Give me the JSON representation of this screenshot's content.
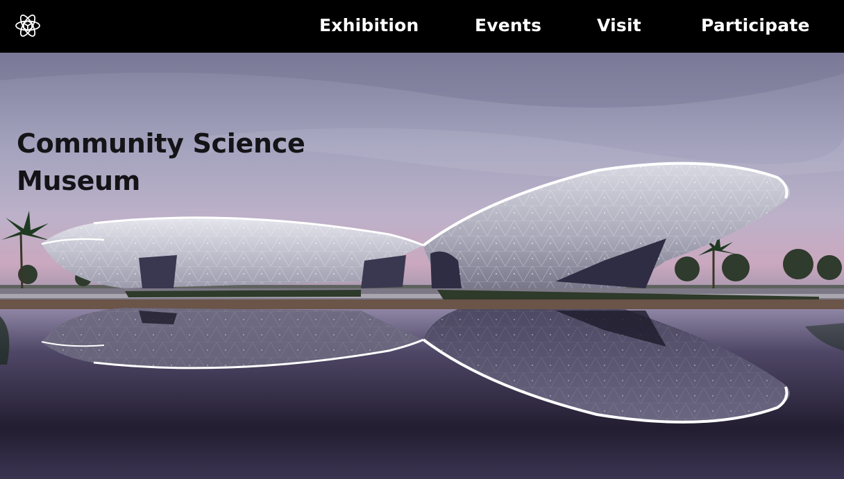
{
  "header": {
    "logo_icon": "atom-cube-icon",
    "nav": [
      {
        "label": "Exhibition"
      },
      {
        "label": "Events"
      },
      {
        "label": "Visit"
      },
      {
        "label": "Participate"
      }
    ]
  },
  "hero": {
    "title_line1": "Community Science",
    "title_line2": "Museum",
    "image_subject": "futuristic-museum-building-with-reflecting-pool-icon"
  },
  "colors": {
    "nav_background": "#000000",
    "nav_text": "#ffffff",
    "title_text": "#141418",
    "sky_top": "#8c8aa6",
    "sky_bottom": "#c8a9bd",
    "water": "#2a2436"
  }
}
